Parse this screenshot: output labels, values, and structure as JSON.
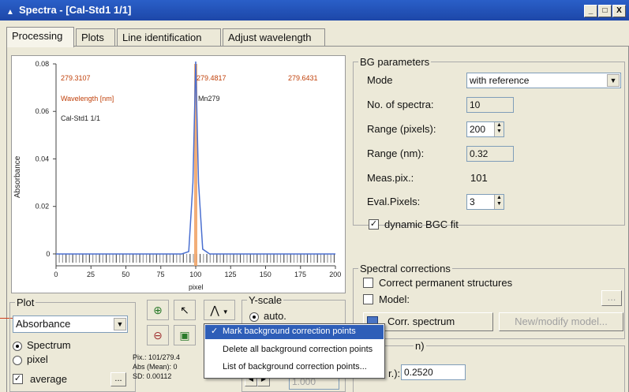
{
  "window": {
    "title": "Spectra - [Cal-Std1 1/1]",
    "buttons": [
      "_",
      "□",
      "X"
    ]
  },
  "tabs": [
    "Processing",
    "Plots",
    "Line identification",
    "Adjust wavelength"
  ],
  "plot": {
    "wl_left": "279.3107",
    "wl_center": "279.4817",
    "wl_right": "279.6431",
    "wavelength_label": "Wavelength [nm]",
    "element_label": "Mn279",
    "sample_label": "Cal-Std1 1/1",
    "ylabel": "Absorbance",
    "xlabel": "pixel"
  },
  "chart_data": {
    "type": "line",
    "xlabel": "pixel",
    "ylabel": "Absorbance",
    "xlim": [
      0,
      200
    ],
    "ylim": [
      -0.005,
      0.08
    ],
    "x_ticks": [
      "0",
      "25",
      "50",
      "75",
      "100",
      "125",
      "150",
      "175",
      "200"
    ],
    "y_ticks": [
      "0",
      "0.02",
      "0.04",
      "0.06",
      "0.08"
    ],
    "series": [
      {
        "x": [
          0,
          90,
          95,
          98,
          100,
          102,
          105,
          110,
          200
        ],
        "values": [
          0,
          0,
          0.001,
          0.03,
          0.081,
          0.03,
          0.002,
          0,
          0
        ]
      }
    ],
    "marker_x": 100
  },
  "bg": {
    "legend": "BG parameters",
    "mode_label": "Mode",
    "mode_value": "with reference",
    "nspec_label": "No. of spectra:",
    "nspec_value": "10",
    "rangepx_label": "Range (pixels):",
    "rangepx_value": "200",
    "rangenm_label": "Range (nm):",
    "rangenm_value": "0.32",
    "measpix_label": "Meas.pix.:",
    "measpix_value": "101",
    "evalpix_label": "Eval.Pixels:",
    "evalpix_value": "3",
    "dynamic_label": "dynamic BGC fit"
  },
  "corrections": {
    "legend": "Spectral corrections",
    "permanent_label": "Correct permanent structures",
    "model_label": "Model:",
    "model_btn": "...",
    "corr_btn": "Corr. spectrum",
    "newmodel_btn": "New/modify model..."
  },
  "bottom": {
    "legend_tail": "n)",
    "field_label": "r.):",
    "field_value": "0.2520"
  },
  "plotpanel": {
    "legend": "Plot",
    "type_value": "Absorbance",
    "spectrum_label": "Spectrum",
    "pixel_label": "pixel",
    "average_label": "average",
    "more_btn": "..."
  },
  "yscale": {
    "legend": "Y-scale",
    "auto_label": "auto.",
    "value": "1.000"
  },
  "info": {
    "line1": "Pix.: 101/279.4",
    "line2": "Abs (Mean): 0",
    "line3": "SD:  0.00112"
  },
  "menu": {
    "items": [
      "Mark background correction points",
      "Delete all background correction points",
      "List of background correction points..."
    ]
  }
}
